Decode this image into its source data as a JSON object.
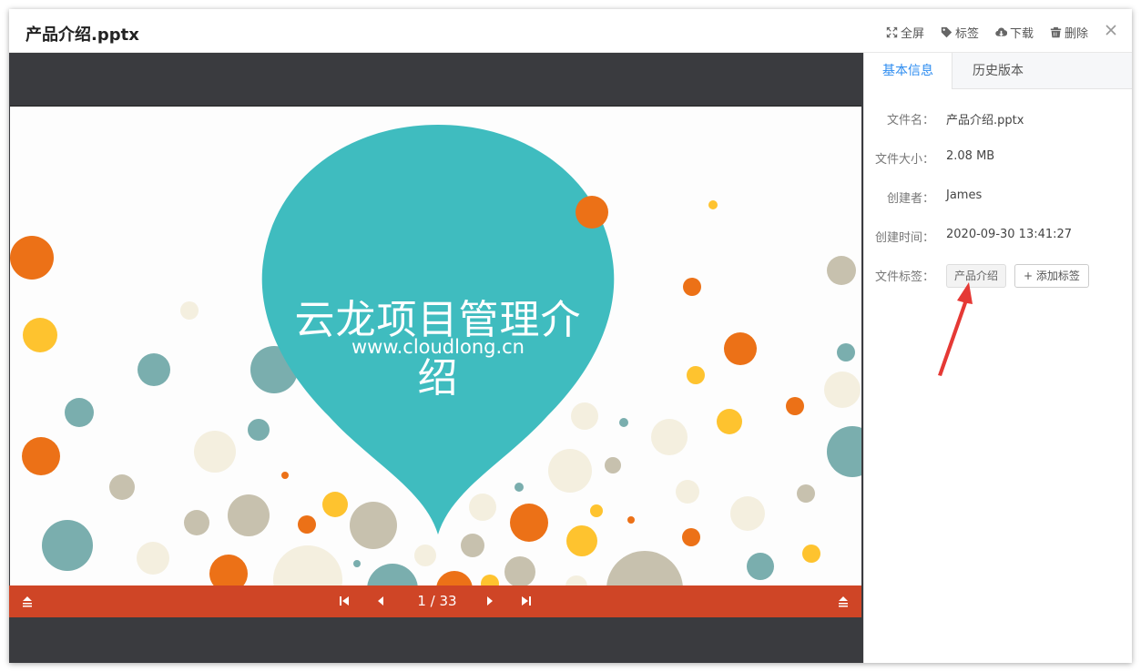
{
  "header": {
    "title": "产品介绍.pptx",
    "actions": {
      "fullscreen": "全屏",
      "tags": "标签",
      "download": "下载",
      "delete": "删除"
    }
  },
  "slide": {
    "title": "云龙项目管理介绍",
    "url": "www.cloudlong.cn"
  },
  "pager": {
    "indicator": "1 / 33"
  },
  "panel": {
    "tabs": [
      "基本信息",
      "历史版本"
    ],
    "fields": {
      "name_label": "文件名：",
      "name_value": "产品介绍.pptx",
      "size_label": "文件大小：",
      "size_value": "2.08 MB",
      "creator_label": "创建者：",
      "creator_value": "James",
      "created_label": "创建时间：",
      "created_value": "2020-09-30 13:41:27",
      "tags_label": "文件标签："
    },
    "tag_items": [
      "产品介绍"
    ],
    "add_tag_label": "+ 添加标签"
  },
  "colors": {
    "accent": "#2d8cf0",
    "nav_bar": "#cf4526",
    "viewer_bg": "#3a3b3f",
    "teal": "#3fbcbf",
    "arrow": "#e53935"
  }
}
